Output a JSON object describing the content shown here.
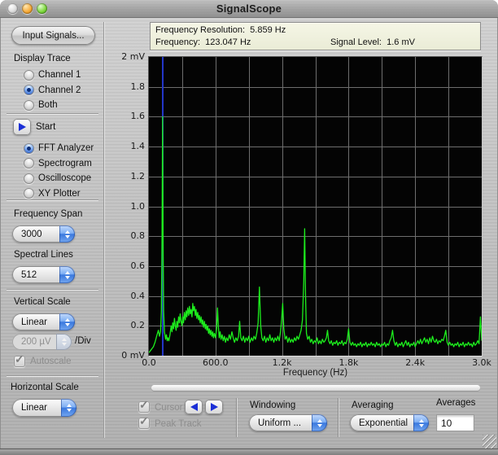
{
  "window": {
    "title": "SignalScope"
  },
  "colors": {
    "accent_blue": "#3a78de",
    "metal": "#c5c5c5",
    "readout_bg": "#eef0dc"
  },
  "sidebar": {
    "input_signals_button": "Input Signals...",
    "display_trace": {
      "label": "Display Trace",
      "options": [
        {
          "label": "Channel 1",
          "selected": false
        },
        {
          "label": "Channel 2",
          "selected": true
        },
        {
          "label": "Both",
          "selected": false
        }
      ]
    },
    "start_label": "Start",
    "mode": {
      "options": [
        {
          "label": "FFT Analyzer",
          "selected": true
        },
        {
          "label": "Spectrogram",
          "selected": false
        },
        {
          "label": "Oscilloscope",
          "selected": false
        },
        {
          "label": "XY Plotter",
          "selected": false
        }
      ]
    },
    "frequency_span": {
      "label": "Frequency Span",
      "value": "3000"
    },
    "spectral_lines": {
      "label": "Spectral Lines",
      "value": "512"
    },
    "vertical_scale": {
      "label": "Vertical Scale",
      "value": "Linear"
    },
    "per_div": {
      "value": "200 µV",
      "suffix": "/Div"
    },
    "autoscale": {
      "label": "Autoscale",
      "checked": true,
      "disabled": true
    },
    "horizontal_scale": {
      "label": "Horizontal Scale",
      "value": "Linear"
    }
  },
  "readout": {
    "resolution": "Frequency Resolution:  5.859 Hz",
    "frequency": "Frequency:  123.047 Hz",
    "signal_level": "Signal Level:  1.6 mV"
  },
  "bottom": {
    "cursor": {
      "label": "Cursor",
      "checked": true,
      "disabled": true
    },
    "peak_track": {
      "label": "Peak Track",
      "checked": true,
      "disabled": true
    },
    "windowing": {
      "label": "Windowing",
      "value": "Uniform ..."
    },
    "averaging": {
      "label": "Averaging",
      "value": "Exponential"
    },
    "averages": {
      "label": "Averages",
      "value": "10"
    }
  },
  "chart_data": {
    "type": "line",
    "xlabel": "Frequency (Hz)",
    "ylabel": "mV",
    "xlim": [
      0,
      3000
    ],
    "ylim": [
      0,
      2
    ],
    "x_ticks": [
      "0.0",
      "600.0",
      "1.2k",
      "1.8k",
      "2.4k",
      "3.0k"
    ],
    "y_ticks": [
      "2 mV",
      "1.8",
      "1.6",
      "1.4",
      "1.2",
      "1.0",
      "0.8",
      "0.6",
      "0.4",
      "0.2",
      "0 mV"
    ],
    "grid": {
      "x_divisions": 10,
      "y_divisions": 10
    },
    "cursor_hz": 123.047,
    "peak": {
      "hz": 123.047,
      "mv": 1.6
    },
    "colors": {
      "trace": "#1ded1d",
      "cursor": "#2336c8",
      "grid": "#6e6e6e",
      "bg": "#040404"
    },
    "points": [
      [
        0,
        0.02
      ],
      [
        20,
        0.04
      ],
      [
        40,
        0.06
      ],
      [
        55,
        0.09
      ],
      [
        70,
        0.13
      ],
      [
        85,
        0.17
      ],
      [
        95,
        0.13
      ],
      [
        105,
        0.16
      ],
      [
        112,
        0.3
      ],
      [
        118,
        0.8
      ],
      [
        123,
        1.6
      ],
      [
        128,
        0.7
      ],
      [
        133,
        0.3
      ],
      [
        140,
        0.16
      ],
      [
        150,
        0.11
      ],
      [
        158,
        0.14
      ],
      [
        165,
        0.1
      ],
      [
        172,
        0.12
      ],
      [
        180,
        0.1
      ],
      [
        190,
        0.14
      ],
      [
        200,
        0.2
      ],
      [
        208,
        0.16
      ],
      [
        215,
        0.22
      ],
      [
        222,
        0.18
      ],
      [
        230,
        0.25
      ],
      [
        238,
        0.2
      ],
      [
        245,
        0.17
      ],
      [
        252,
        0.23
      ],
      [
        260,
        0.19
      ],
      [
        268,
        0.26
      ],
      [
        275,
        0.22
      ],
      [
        282,
        0.28
      ],
      [
        290,
        0.23
      ],
      [
        298,
        0.2
      ],
      [
        305,
        0.26
      ],
      [
        312,
        0.22
      ],
      [
        320,
        0.29
      ],
      [
        328,
        0.24
      ],
      [
        335,
        0.3
      ],
      [
        342,
        0.26
      ],
      [
        350,
        0.32
      ],
      [
        358,
        0.27
      ],
      [
        365,
        0.33
      ],
      [
        372,
        0.28
      ],
      [
        380,
        0.31
      ],
      [
        388,
        0.26
      ],
      [
        395,
        0.35
      ],
      [
        402,
        0.3
      ],
      [
        410,
        0.33
      ],
      [
        418,
        0.27
      ],
      [
        425,
        0.31
      ],
      [
        432,
        0.25
      ],
      [
        440,
        0.29
      ],
      [
        448,
        0.24
      ],
      [
        455,
        0.27
      ],
      [
        462,
        0.22
      ],
      [
        470,
        0.26
      ],
      [
        478,
        0.21
      ],
      [
        485,
        0.24
      ],
      [
        492,
        0.19
      ],
      [
        500,
        0.23
      ],
      [
        508,
        0.18
      ],
      [
        515,
        0.21
      ],
      [
        522,
        0.17
      ],
      [
        530,
        0.2
      ],
      [
        538,
        0.15
      ],
      [
        545,
        0.18
      ],
      [
        552,
        0.14
      ],
      [
        560,
        0.17
      ],
      [
        568,
        0.13
      ],
      [
        575,
        0.16
      ],
      [
        582,
        0.12
      ],
      [
        590,
        0.15
      ],
      [
        600,
        0.12
      ],
      [
        610,
        0.18
      ],
      [
        618,
        0.32
      ],
      [
        626,
        0.2
      ],
      [
        634,
        0.12
      ],
      [
        642,
        0.16
      ],
      [
        650,
        0.11
      ],
      [
        660,
        0.14
      ],
      [
        670,
        0.1
      ],
      [
        680,
        0.13
      ],
      [
        690,
        0.09
      ],
      [
        700,
        0.12
      ],
      [
        712,
        0.1
      ],
      [
        724,
        0.14
      ],
      [
        736,
        0.11
      ],
      [
        748,
        0.16
      ],
      [
        760,
        0.12
      ],
      [
        772,
        0.09
      ],
      [
        784,
        0.12
      ],
      [
        796,
        0.1
      ],
      [
        808,
        0.13
      ],
      [
        818,
        0.23
      ],
      [
        828,
        0.12
      ],
      [
        840,
        0.1
      ],
      [
        852,
        0.13
      ],
      [
        864,
        0.09
      ],
      [
        876,
        0.12
      ],
      [
        888,
        0.1
      ],
      [
        900,
        0.13
      ],
      [
        912,
        0.09
      ],
      [
        924,
        0.12
      ],
      [
        936,
        0.1
      ],
      [
        948,
        0.13
      ],
      [
        960,
        0.11
      ],
      [
        972,
        0.15
      ],
      [
        984,
        0.22
      ],
      [
        996,
        0.46
      ],
      [
        1008,
        0.2
      ],
      [
        1018,
        0.12
      ],
      [
        1030,
        0.1
      ],
      [
        1042,
        0.13
      ],
      [
        1054,
        0.09
      ],
      [
        1066,
        0.12
      ],
      [
        1078,
        0.1
      ],
      [
        1090,
        0.14
      ],
      [
        1102,
        0.1
      ],
      [
        1114,
        0.12
      ],
      [
        1126,
        0.09
      ],
      [
        1138,
        0.12
      ],
      [
        1150,
        0.1
      ],
      [
        1162,
        0.13
      ],
      [
        1174,
        0.1
      ],
      [
        1186,
        0.16
      ],
      [
        1196,
        0.24
      ],
      [
        1206,
        0.35
      ],
      [
        1216,
        0.18
      ],
      [
        1228,
        0.11
      ],
      [
        1240,
        0.13
      ],
      [
        1252,
        0.09
      ],
      [
        1264,
        0.12
      ],
      [
        1276,
        0.09
      ],
      [
        1288,
        0.11
      ],
      [
        1300,
        0.09
      ],
      [
        1312,
        0.12
      ],
      [
        1324,
        0.1
      ],
      [
        1336,
        0.13
      ],
      [
        1348,
        0.11
      ],
      [
        1360,
        0.14
      ],
      [
        1372,
        0.17
      ],
      [
        1384,
        0.24
      ],
      [
        1396,
        0.5
      ],
      [
        1404,
        0.85
      ],
      [
        1412,
        0.4
      ],
      [
        1420,
        0.15
      ],
      [
        1432,
        0.11
      ],
      [
        1444,
        0.13
      ],
      [
        1456,
        0.09
      ],
      [
        1468,
        0.11
      ],
      [
        1480,
        0.08
      ],
      [
        1492,
        0.1
      ],
      [
        1504,
        0.09
      ],
      [
        1516,
        0.12
      ],
      [
        1528,
        0.08
      ],
      [
        1540,
        0.1
      ],
      [
        1552,
        0.08
      ],
      [
        1564,
        0.11
      ],
      [
        1576,
        0.09
      ],
      [
        1588,
        0.1
      ],
      [
        1600,
        0.12
      ],
      [
        1610,
        0.17
      ],
      [
        1620,
        0.1
      ],
      [
        1632,
        0.08
      ],
      [
        1644,
        0.1
      ],
      [
        1656,
        0.07
      ],
      [
        1668,
        0.09
      ],
      [
        1680,
        0.08
      ],
      [
        1692,
        0.1
      ],
      [
        1704,
        0.07
      ],
      [
        1716,
        0.09
      ],
      [
        1728,
        0.08
      ],
      [
        1740,
        0.1
      ],
      [
        1752,
        0.07
      ],
      [
        1764,
        0.09
      ],
      [
        1776,
        0.08
      ],
      [
        1788,
        0.11
      ],
      [
        1800,
        0.18
      ],
      [
        1812,
        0.09
      ],
      [
        1824,
        0.07
      ],
      [
        1836,
        0.09
      ],
      [
        1848,
        0.07
      ],
      [
        1860,
        0.08
      ],
      [
        1872,
        0.06
      ],
      [
        1884,
        0.08
      ],
      [
        1896,
        0.07
      ],
      [
        1908,
        0.09
      ],
      [
        1920,
        0.06
      ],
      [
        1932,
        0.08
      ],
      [
        1944,
        0.07
      ],
      [
        1956,
        0.09
      ],
      [
        1968,
        0.06
      ],
      [
        1980,
        0.08
      ],
      [
        1992,
        0.07
      ],
      [
        2004,
        0.09
      ],
      [
        2016,
        0.07
      ],
      [
        2028,
        0.08
      ],
      [
        2040,
        0.06
      ],
      [
        2052,
        0.09
      ],
      [
        2064,
        0.07
      ],
      [
        2076,
        0.08
      ],
      [
        2088,
        0.06
      ],
      [
        2100,
        0.08
      ],
      [
        2112,
        0.07
      ],
      [
        2124,
        0.09
      ],
      [
        2136,
        0.06
      ],
      [
        2148,
        0.08
      ],
      [
        2160,
        0.07
      ],
      [
        2172,
        0.1
      ],
      [
        2184,
        0.12
      ],
      [
        2196,
        0.17
      ],
      [
        2208,
        0.1
      ],
      [
        2220,
        0.07
      ],
      [
        2232,
        0.09
      ],
      [
        2244,
        0.06
      ],
      [
        2256,
        0.08
      ],
      [
        2268,
        0.07
      ],
      [
        2280,
        0.09
      ],
      [
        2292,
        0.06
      ],
      [
        2304,
        0.08
      ],
      [
        2316,
        0.1
      ],
      [
        2328,
        0.07
      ],
      [
        2340,
        0.09
      ],
      [
        2352,
        0.06
      ],
      [
        2364,
        0.08
      ],
      [
        2376,
        0.07
      ],
      [
        2388,
        0.09
      ],
      [
        2400,
        0.06
      ],
      [
        2412,
        0.08
      ],
      [
        2424,
        0.1
      ],
      [
        2436,
        0.08
      ],
      [
        2448,
        0.11
      ],
      [
        2460,
        0.08
      ],
      [
        2472,
        0.1
      ],
      [
        2484,
        0.12
      ],
      [
        2496,
        0.09
      ],
      [
        2508,
        0.11
      ],
      [
        2520,
        0.08
      ],
      [
        2532,
        0.12
      ],
      [
        2544,
        0.09
      ],
      [
        2556,
        0.13
      ],
      [
        2568,
        0.1
      ],
      [
        2580,
        0.09
      ],
      [
        2592,
        0.11
      ],
      [
        2604,
        0.08
      ],
      [
        2616,
        0.1
      ],
      [
        2628,
        0.09
      ],
      [
        2640,
        0.11
      ],
      [
        2652,
        0.1
      ],
      [
        2664,
        0.13
      ],
      [
        2676,
        0.17
      ],
      [
        2688,
        0.09
      ],
      [
        2700,
        0.07
      ],
      [
        2712,
        0.09
      ],
      [
        2724,
        0.07
      ],
      [
        2736,
        0.08
      ],
      [
        2748,
        0.06
      ],
      [
        2760,
        0.08
      ],
      [
        2772,
        0.07
      ],
      [
        2784,
        0.09
      ],
      [
        2796,
        0.06
      ],
      [
        2808,
        0.08
      ],
      [
        2820,
        0.07
      ],
      [
        2832,
        0.09
      ],
      [
        2844,
        0.06
      ],
      [
        2856,
        0.08
      ],
      [
        2868,
        0.07
      ],
      [
        2880,
        0.09
      ],
      [
        2892,
        0.07
      ],
      [
        2904,
        0.08
      ],
      [
        2916,
        0.06
      ],
      [
        2928,
        0.09
      ],
      [
        2940,
        0.07
      ],
      [
        2952,
        0.08
      ],
      [
        2964,
        0.1
      ],
      [
        2976,
        0.08
      ],
      [
        2988,
        0.26
      ],
      [
        3000,
        0.1
      ]
    ]
  }
}
